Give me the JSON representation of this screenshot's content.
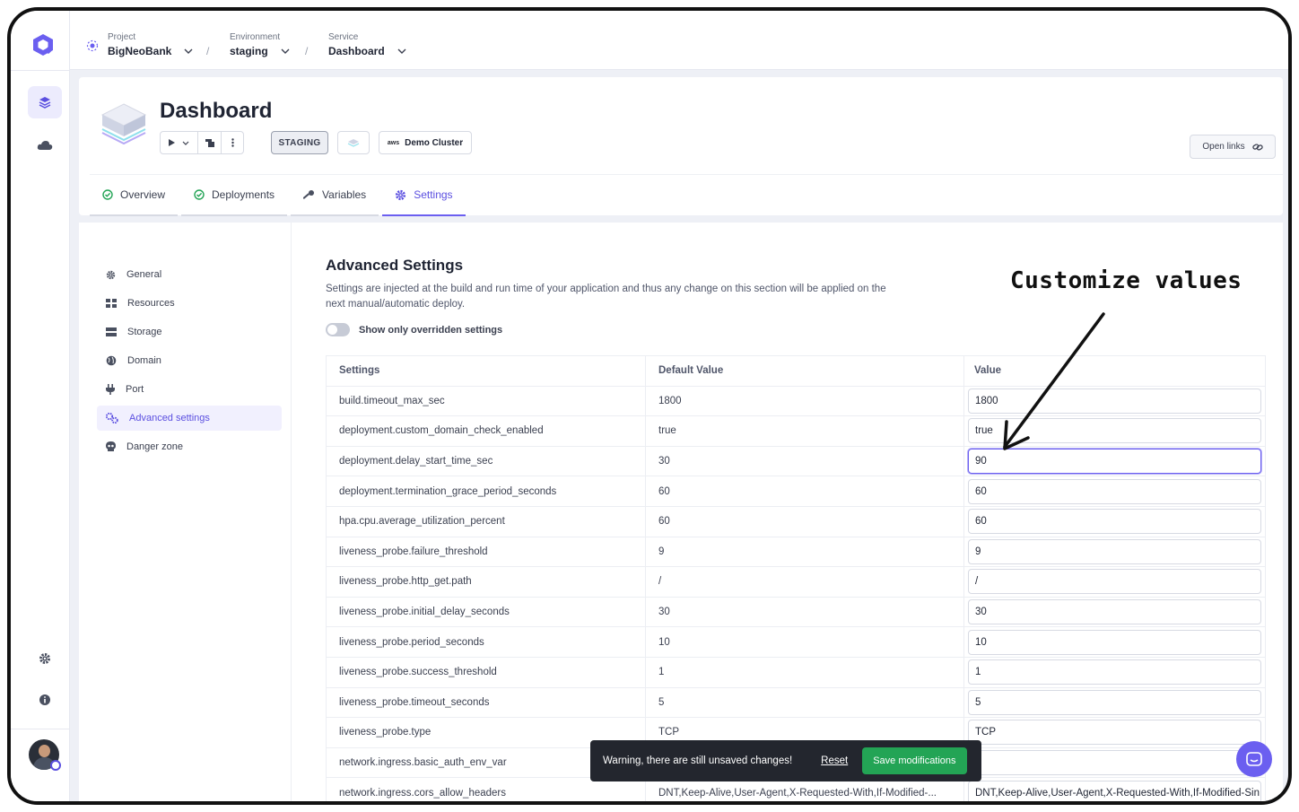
{
  "breadcrumbs": [
    {
      "label": "Project",
      "value": "BigNeoBank"
    },
    {
      "label": "Environment",
      "value": "staging"
    },
    {
      "label": "Service",
      "value": "Dashboard"
    }
  ],
  "separator": "/",
  "service": {
    "title": "Dashboard",
    "env_badge": "STAGING",
    "cluster": "Demo Cluster",
    "cluster_provider": "aws",
    "open_links": "Open links"
  },
  "tabs": [
    {
      "label": "Overview",
      "icon": "check-circle-icon"
    },
    {
      "label": "Deployments",
      "icon": "check-circle-icon"
    },
    {
      "label": "Variables",
      "icon": "key-icon"
    },
    {
      "label": "Settings",
      "icon": "gear-icon",
      "active": true
    }
  ],
  "settings_nav": [
    {
      "label": "General",
      "icon": "gear-icon"
    },
    {
      "label": "Resources",
      "icon": "resources-icon"
    },
    {
      "label": "Storage",
      "icon": "storage-icon"
    },
    {
      "label": "Domain",
      "icon": "globe-icon"
    },
    {
      "label": "Port",
      "icon": "plug-icon"
    },
    {
      "label": "Advanced settings",
      "icon": "gears-icon",
      "active": true
    },
    {
      "label": "Danger zone",
      "icon": "skull-icon"
    }
  ],
  "advanced": {
    "title": "Advanced Settings",
    "description": "Settings are injected at the build and run time of your application and thus any change on this section will be applied on the next manual/automatic deploy.",
    "toggle_label": "Show only overridden settings",
    "columns": [
      "Settings",
      "Default Value",
      "Value"
    ],
    "rows": [
      {
        "key": "build.timeout_max_sec",
        "default": "1800",
        "value": "1800"
      },
      {
        "key": "deployment.custom_domain_check_enabled",
        "default": "true",
        "value": "true"
      },
      {
        "key": "deployment.delay_start_time_sec",
        "default": "30",
        "value": "90",
        "focused": true
      },
      {
        "key": "deployment.termination_grace_period_seconds",
        "default": "60",
        "value": "60"
      },
      {
        "key": "hpa.cpu.average_utilization_percent",
        "default": "60",
        "value": "60"
      },
      {
        "key": "liveness_probe.failure_threshold",
        "default": "9",
        "value": "9"
      },
      {
        "key": "liveness_probe.http_get.path",
        "default": "/",
        "value": "/"
      },
      {
        "key": "liveness_probe.initial_delay_seconds",
        "default": "30",
        "value": "30"
      },
      {
        "key": "liveness_probe.period_seconds",
        "default": "10",
        "value": "10"
      },
      {
        "key": "liveness_probe.success_threshold",
        "default": "1",
        "value": "1"
      },
      {
        "key": "liveness_probe.timeout_seconds",
        "default": "5",
        "value": "5"
      },
      {
        "key": "liveness_probe.type",
        "default": "TCP",
        "value": "TCP"
      },
      {
        "key": "network.ingress.basic_auth_env_var",
        "default": "",
        "value": ""
      },
      {
        "key": "network.ingress.cors_allow_headers",
        "default": "DNT,Keep-Alive,User-Agent,X-Requested-With,If-Modified-...",
        "value": "DNT,Keep-Alive,User-Agent,X-Requested-With,If-Modified-Sin"
      }
    ]
  },
  "toast": {
    "message": "Warning, there are still unsaved changes!",
    "reset": "Reset",
    "save": "Save modifications"
  },
  "annotation": "Customize values",
  "colors": {
    "accent": "#6b5ff0",
    "save": "#23a455",
    "toast_bg": "#23262e"
  }
}
